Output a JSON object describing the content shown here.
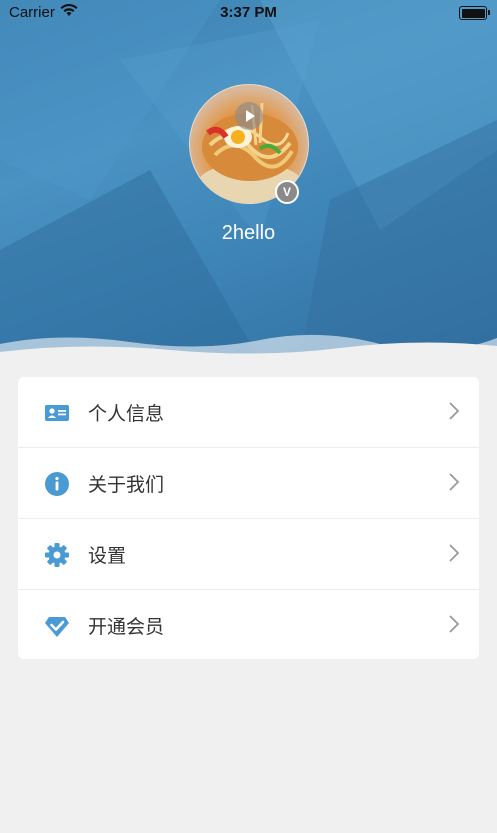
{
  "status_bar": {
    "carrier": "Carrier",
    "time": "3:37 PM"
  },
  "profile": {
    "username": "2hello",
    "badge": "V"
  },
  "menu": {
    "items": [
      {
        "label": "个人信息",
        "icon": "id-card-icon"
      },
      {
        "label": "关于我们",
        "icon": "info-icon"
      },
      {
        "label": "设置",
        "icon": "gear-icon"
      },
      {
        "label": "开通会员",
        "icon": "diamond-check-icon"
      }
    ]
  },
  "colors": {
    "accent": "#4a9ad4",
    "header": "#3f86b8",
    "background": "#f0f0f0"
  }
}
